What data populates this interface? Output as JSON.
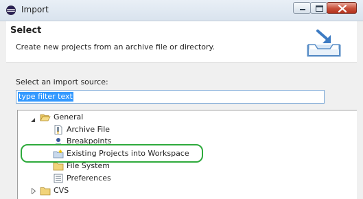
{
  "window": {
    "title": "Import"
  },
  "header": {
    "title": "Select",
    "description": "Create new projects from an archive file or directory."
  },
  "source": {
    "label": "Select an import source:",
    "filter_value": "type filter text"
  },
  "tree": {
    "items": [
      {
        "label": "General",
        "expanded": true,
        "icon": "folder-open-icon"
      },
      {
        "label": "Archive File",
        "icon": "archive-file-icon"
      },
      {
        "label": "Breakpoints",
        "icon": "breakpoints-icon"
      },
      {
        "label": "Existing Projects into Workspace",
        "icon": "existing-projects-icon",
        "highlighted": true
      },
      {
        "label": "File System",
        "icon": "folder-icon"
      },
      {
        "label": "Preferences",
        "icon": "preferences-icon"
      },
      {
        "label": "CVS",
        "expanded": false,
        "icon": "folder-icon"
      }
    ]
  },
  "colors": {
    "highlight": "#2eaa3c",
    "selection": "#3399ff"
  }
}
